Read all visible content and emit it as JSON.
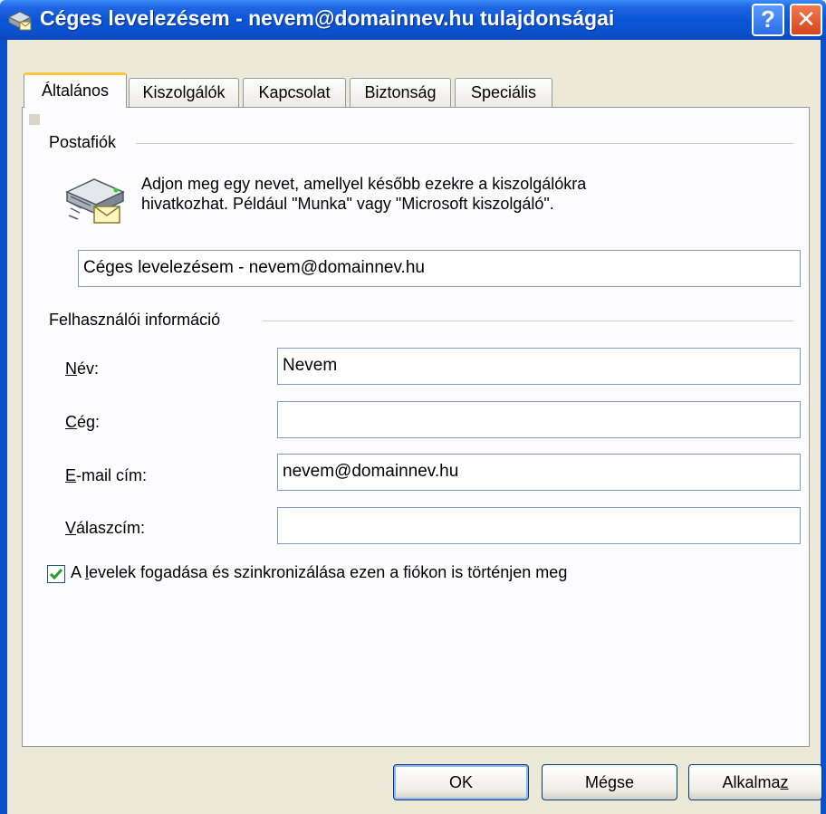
{
  "window": {
    "title": "Céges levelezésem - nevem@domainnev.hu tulajdonságai",
    "help_glyph": "?",
    "close_glyph": "✕"
  },
  "tabs": [
    {
      "label": "Általános",
      "active": true
    },
    {
      "label": "Kiszolgálók",
      "active": false
    },
    {
      "label": "Kapcsolat",
      "active": false
    },
    {
      "label": "Biztonság",
      "active": false
    },
    {
      "label": "Speciális",
      "active": false
    }
  ],
  "mailbox": {
    "group_label": "Postafiók",
    "description_line1": "Adjon meg egy nevet, amellyel később ezekre a kiszolgálókra",
    "description_line2": "hivatkozhat. Például \"Munka\" vagy \"Microsoft kiszolgáló\".",
    "account_name": "Céges levelezésem - nevem@domainnev.hu",
    "icon": "mail-server-icon"
  },
  "user_info": {
    "group_label": "Felhasználói információ",
    "name": {
      "label_mnemonic": "N",
      "label_rest": "év:",
      "value": "Nevem"
    },
    "company": {
      "label_mnemonic": "C",
      "label_rest": "ég:",
      "value": ""
    },
    "email": {
      "label_mnemonic": "E",
      "label_rest": "-mail cím:",
      "value": "nevem@domainnev.hu"
    },
    "reply": {
      "label_mnemonic": "V",
      "label_rest": "álaszcím:",
      "value": ""
    }
  },
  "sync": {
    "checked": true,
    "label_before": "A ",
    "label_mnemonic": "l",
    "label_after": "evelek fogadása és szinkronizálása ezen a fiókon is történjen meg"
  },
  "buttons": {
    "ok": "OK",
    "cancel": "Mégse",
    "apply_before": "Alkalma",
    "apply_mnemonic": "z"
  },
  "colors": {
    "titlebar": "#0a56d8",
    "dialog_bg": "#ece9d8",
    "tab_accent": "#ffc83c",
    "check": "#21a121"
  }
}
